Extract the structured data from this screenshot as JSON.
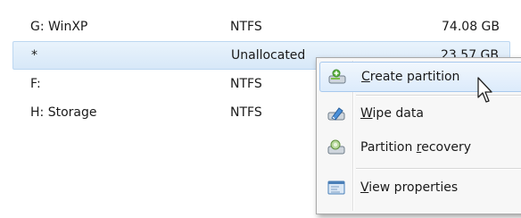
{
  "partitions": [
    {
      "name": "G: WinXP",
      "fs": "NTFS",
      "size": "74.08 GB"
    },
    {
      "name": "*",
      "fs": "Unallocated",
      "size": "23.57 GB"
    },
    {
      "name": "F:",
      "fs": "NTFS",
      "size": ""
    },
    {
      "name": "H: Storage",
      "fs": "NTFS",
      "size": ""
    }
  ],
  "context_menu": {
    "items": [
      {
        "pre": "",
        "u": "C",
        "post": "reate partition",
        "icon": "create-partition-icon"
      },
      {
        "pre": "",
        "u": "W",
        "post": "ipe data",
        "icon": "wipe-data-icon"
      },
      {
        "pre": "Partition ",
        "u": "r",
        "post": "ecovery",
        "icon": "partition-recovery-icon"
      },
      {
        "pre": "",
        "u": "V",
        "post": "iew properties",
        "icon": "view-properties-icon"
      }
    ]
  }
}
